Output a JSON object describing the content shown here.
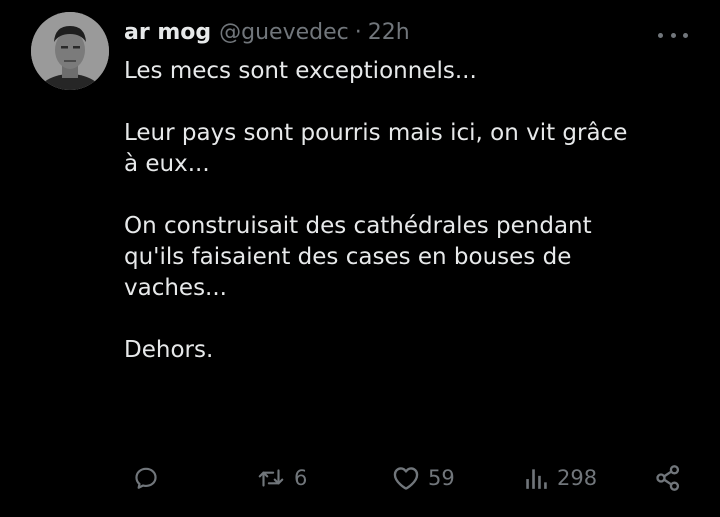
{
  "tweet": {
    "author_name": "ar mog",
    "handle": "@guevedec",
    "separator": "·",
    "time": "22h",
    "paragraphs": [
      {
        "lines": [
          "Les mecs sont exceptionnels..."
        ]
      },
      {
        "lines": [
          "Leur pays sont pourris mais ici, on vit grâce",
          "à eux..."
        ]
      },
      {
        "lines": [
          "On construisait des cathédrales pendant",
          "qu'ils faisaient des cases en bouses de",
          "vaches..."
        ]
      },
      {
        "lines": [
          "Dehors."
        ]
      }
    ]
  },
  "actions": {
    "reply_icon": "reply-icon",
    "retweet_icon": "retweet-icon",
    "retweet_count": "6",
    "like_icon": "heart-icon",
    "like_count": "59",
    "views_icon": "views-icon",
    "views_count": "298",
    "share_icon": "share-icon",
    "more_icon": "more-icon"
  },
  "colors": {
    "background": "#000000",
    "text": "#e7e9ea",
    "secondary": "#71767b"
  }
}
